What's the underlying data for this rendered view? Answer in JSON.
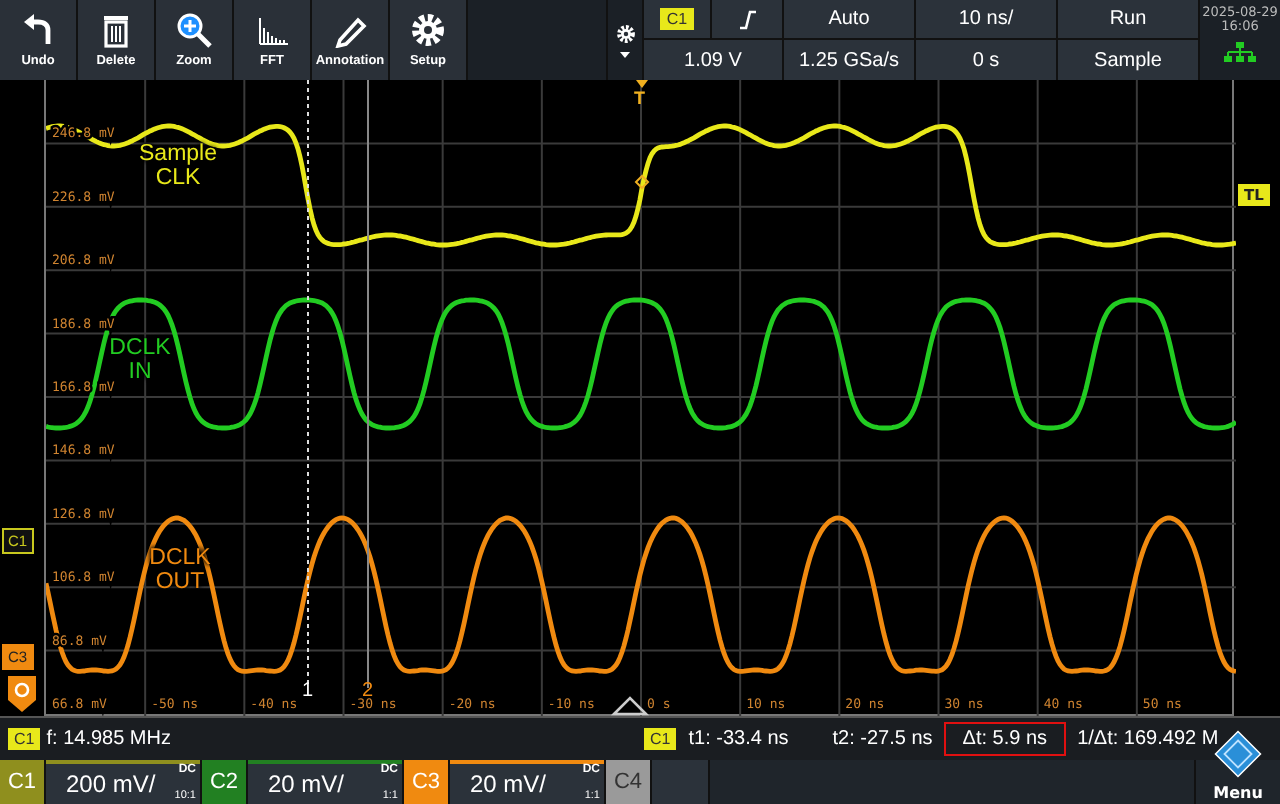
{
  "toolbar": [
    {
      "kind": "undo",
      "label": "Undo"
    },
    {
      "kind": "delete",
      "label": "Delete"
    },
    {
      "kind": "zoom",
      "label": "Zoom"
    },
    {
      "kind": "fft",
      "label": "FFT"
    },
    {
      "kind": "annotation",
      "label": "Annotation"
    },
    {
      "kind": "setup",
      "label": "Setup"
    }
  ],
  "settings": {
    "source": "C1",
    "mode": "Auto",
    "timebase": "10 ns/",
    "run_state": "Run",
    "trigger_level": "1.09 V",
    "sample_rate": "1.25 GSa/s",
    "position": "0 s",
    "acquisition": "Sample",
    "date": "2025-08-29",
    "time": "16:06"
  },
  "plot": {
    "y_labels": [
      "246.8 mV",
      "226.8 mV",
      "206.8 mV",
      "186.8 mV",
      "166.8 mV",
      "146.8 mV",
      "126.8 mV",
      "106.8 mV",
      "86.8 mV",
      "66.8 mV"
    ],
    "x_labels": [
      "-50 ns",
      "-40 ns",
      "-30 ns",
      "-20 ns",
      "-10 ns",
      "0 s",
      "10 ns",
      "20 ns",
      "30 ns",
      "40 ns",
      "50 ns"
    ],
    "cursors": [
      {
        "label": "1"
      },
      {
        "label": "2"
      }
    ],
    "trigger_marker": "T",
    "right_tag": "TL"
  },
  "left_markers": [
    {
      "label": "C1",
      "kind": "outline",
      "color": "#c8c81e"
    },
    {
      "label": "C3",
      "kind": "filled",
      "color": "#f08a10"
    }
  ],
  "measurement": {
    "source": "C1",
    "frequency": "f: 14.985 MHz"
  },
  "cursor_readout": {
    "source": "C1",
    "t1": "t1: -33.4 ns",
    "t2": "t2: -27.5 ns",
    "delta": "Δt: 5.9 ns",
    "delta_highlighted": true,
    "inverse": "1/Δt: 169.492 M"
  },
  "channels": [
    {
      "name": "C1",
      "on": true,
      "selected": false,
      "color": "#e8e81a",
      "scale": "200 mV/",
      "coupling": "DC",
      "probe": "10:1",
      "trace_label": "Sample CLK"
    },
    {
      "name": "C2",
      "on": true,
      "selected": false,
      "color": "#22cc22",
      "scale": "20 mV/",
      "coupling": "DC",
      "probe": "1:1",
      "trace_label": "DCLK IN"
    },
    {
      "name": "C3",
      "on": true,
      "selected": true,
      "color": "#f08a10",
      "scale": "20 mV/",
      "coupling": "DC",
      "probe": "1:1",
      "trace_label": "DCLK OUT"
    },
    {
      "name": "C4",
      "on": false,
      "selected": false
    }
  ],
  "menu": {
    "label": "Menu"
  }
}
